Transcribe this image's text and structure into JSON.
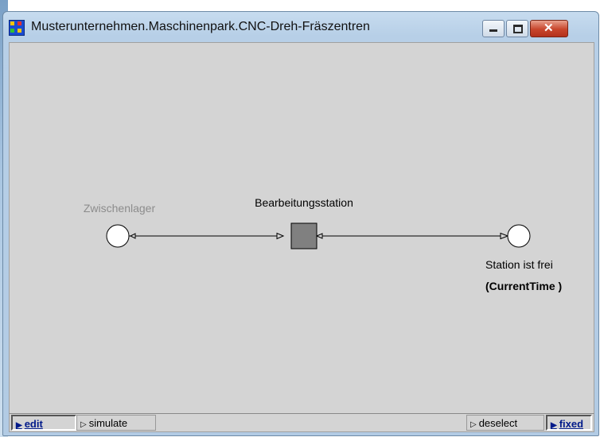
{
  "window": {
    "title": "Musterunternehmen.Maschinenpark.CNC-Dreh-Fräszentren"
  },
  "net": {
    "place_left_label": "Zwischenlager",
    "transition_label": "Bearbeitungsstation",
    "place_right_label": "Station ist frei",
    "place_right_sublabel": "(CurrentTime )"
  },
  "statusbar": {
    "edit": "edit",
    "simulate": "simulate",
    "deselect": "deselect",
    "fixed": "fixed"
  },
  "colors": {
    "canvas": "#d4d4d4",
    "place_fill": "#ffffff",
    "transition_fill": "#808080",
    "inactive_label": "#8c8c8c"
  }
}
